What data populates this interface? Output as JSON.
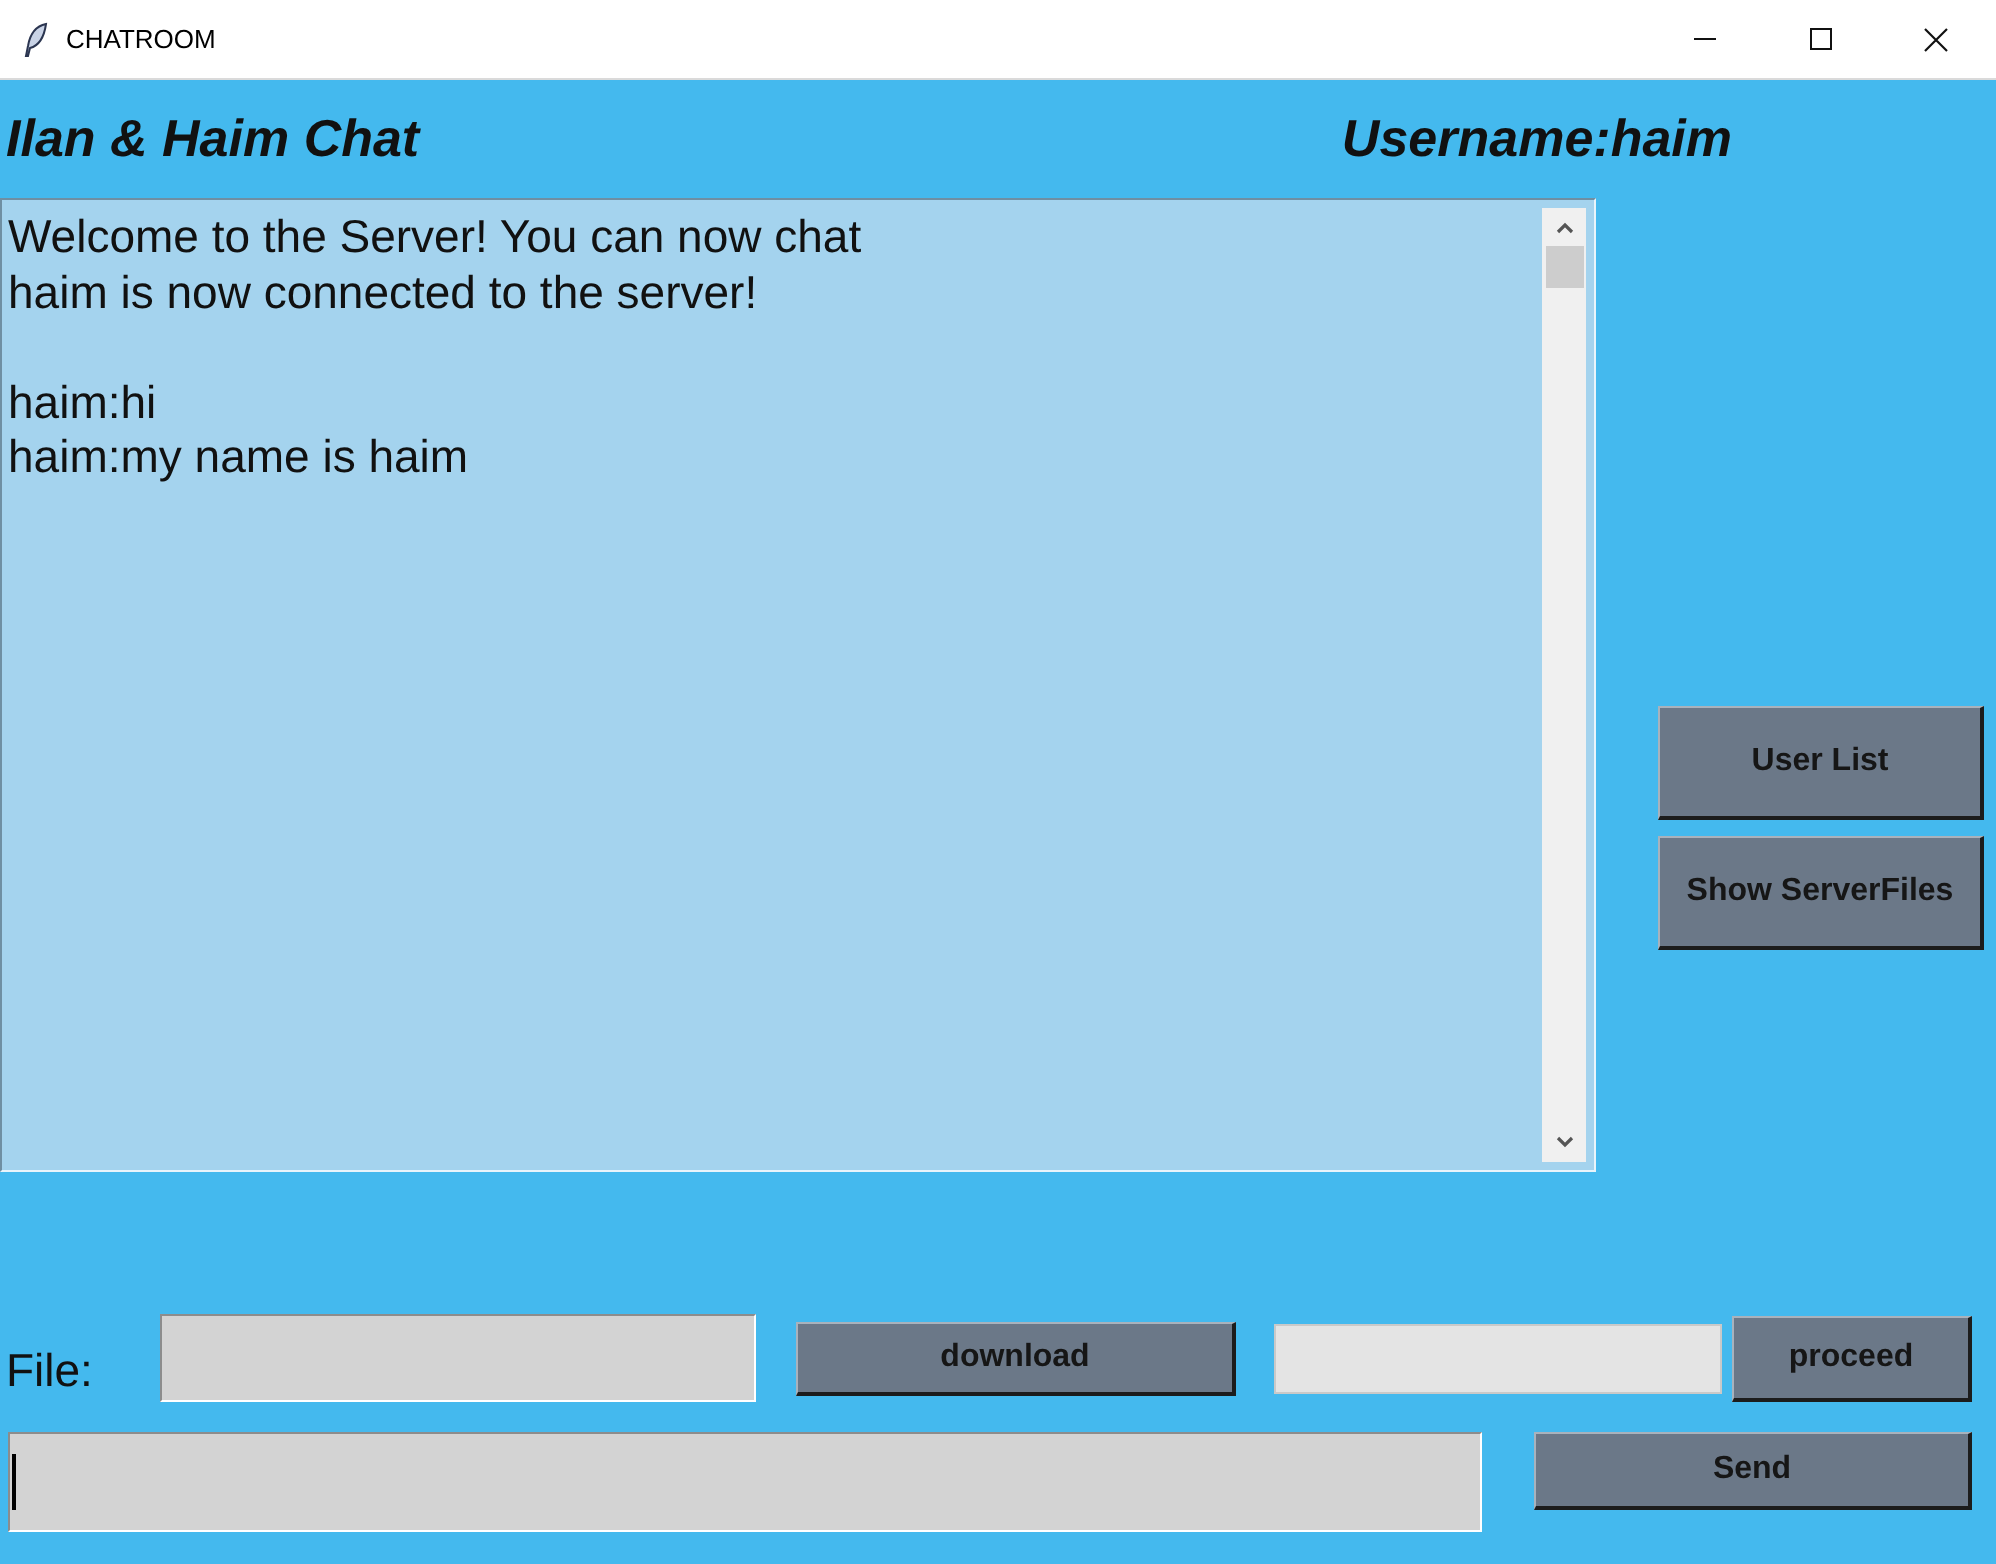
{
  "window": {
    "title": "CHATROOM"
  },
  "header": {
    "title": "Ilan & Haim Chat",
    "username": "Username:haim"
  },
  "chat": {
    "blocks": [
      [
        "Welcome to the Server! You can now chat",
        "haim is now connected to the server!"
      ],
      [
        "haim:hi",
        "haim:my name is haim"
      ]
    ]
  },
  "side_buttons": [
    "User List",
    "Show ServerFiles"
  ],
  "file_row": {
    "label": "File:",
    "download_button": "download",
    "proceed_button": "proceed"
  },
  "message_field": {
    "focused": true
  },
  "send_button": "Send"
}
